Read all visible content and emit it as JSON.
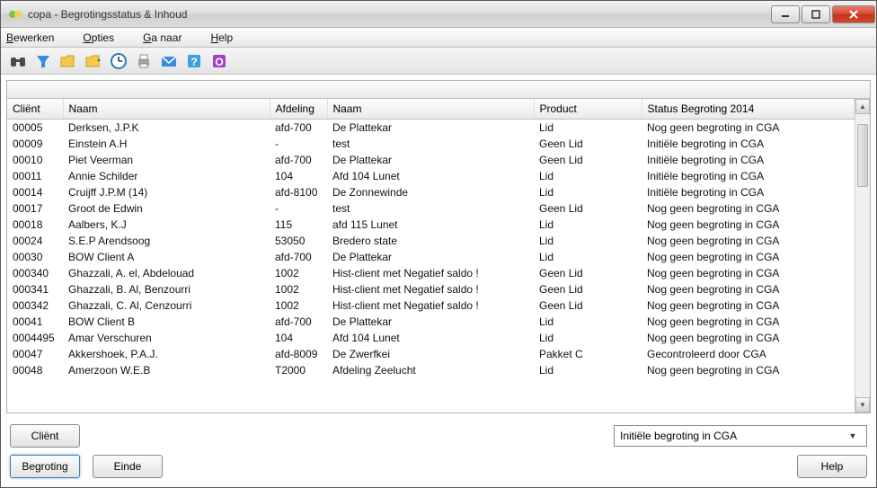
{
  "window": {
    "title": "copa - Begrotingsstatus & Inhoud"
  },
  "menu": {
    "bewerken": "Bewerken",
    "opties": "Opties",
    "ga_naar": "Ga naar",
    "help": "Help"
  },
  "columns": {
    "client": "Cliënt",
    "naam": "Naam",
    "afdeling": "Afdeling",
    "naam2": "Naam",
    "product": "Product",
    "status": "Status Begroting 2014"
  },
  "rows": [
    {
      "client": "00005",
      "naam": "Derksen, J.P.K",
      "afdeling": "afd-700",
      "naam2": "De Plattekar",
      "product": "Lid",
      "status": "Nog geen begroting in CGA"
    },
    {
      "client": "00009",
      "naam": "Einstein  A.H",
      "afdeling": "-",
      "naam2": "test",
      "product": "Geen Lid",
      "status": "Initiële begroting in CGA"
    },
    {
      "client": "00010",
      "naam": "Piet Veerman",
      "afdeling": "afd-700",
      "naam2": "De Plattekar",
      "product": "Geen Lid",
      "status": "Initiële begroting in CGA"
    },
    {
      "client": "00011",
      "naam": "Annie Schilder",
      "afdeling": "104",
      "naam2": "Afd 104 Lunet",
      "product": "Lid",
      "status": "Initiële begroting in CGA"
    },
    {
      "client": "00014",
      "naam": "Cruijff J.P.M (14)",
      "afdeling": "afd-8100",
      "naam2": "De Zonnewinde",
      "product": "Lid",
      "status": "Initiële begroting in CGA"
    },
    {
      "client": "00017",
      "naam": "Groot de Edwin",
      "afdeling": "-",
      "naam2": "test",
      "product": "Geen Lid",
      "status": "Nog geen begroting in CGA"
    },
    {
      "client": "00018",
      "naam": "Aalbers, K.J",
      "afdeling": "115",
      "naam2": "afd 115 Lunet",
      "product": "Lid",
      "status": "Nog geen begroting in CGA"
    },
    {
      "client": "00024",
      "naam": "S.E.P Arendsoog",
      "afdeling": "53050",
      "naam2": "Bredero state",
      "product": "Lid",
      "status": "Nog geen begroting in CGA"
    },
    {
      "client": "00030",
      "naam": "BOW Client A",
      "afdeling": "afd-700",
      "naam2": "De Plattekar",
      "product": "Lid",
      "status": "Nog geen begroting in CGA"
    },
    {
      "client": "000340",
      "naam": "Ghazzali, A. el, Abdelouad",
      "afdeling": "1002",
      "naam2": "Hist-client met Negatief saldo !",
      "product": "Geen Lid",
      "status": "Nog geen begroting in CGA"
    },
    {
      "client": "000341",
      "naam": "Ghazzali, B. Al, Benzourri",
      "afdeling": "1002",
      "naam2": "Hist-client met Negatief saldo !",
      "product": "Geen Lid",
      "status": "Nog geen begroting in CGA"
    },
    {
      "client": "000342",
      "naam": "Ghazzali, C. Al, Cenzourri",
      "afdeling": "1002",
      "naam2": "Hist-client met Negatief saldo !",
      "product": "Geen Lid",
      "status": "Nog geen begroting in CGA"
    },
    {
      "client": "00041",
      "naam": "BOW Client B",
      "afdeling": "afd-700",
      "naam2": "De Plattekar",
      "product": "Lid",
      "status": "Nog geen begroting in CGA"
    },
    {
      "client": "0004495",
      "naam": "Amar Verschuren",
      "afdeling": "104",
      "naam2": "Afd 104 Lunet",
      "product": "Lid",
      "status": "Nog geen begroting in CGA"
    },
    {
      "client": "00047",
      "naam": "Akkershoek, P.A.J.",
      "afdeling": "afd-8009",
      "naam2": "De Zwerfkei",
      "product": "Pakket C",
      "status": "Gecontroleerd door CGA"
    },
    {
      "client": "00048",
      "naam": "Amerzoon W.E.B",
      "afdeling": "T2000",
      "naam2": "Afdeling Zeelucht",
      "product": "Lid",
      "status": "Nog geen begroting in CGA"
    }
  ],
  "bottom": {
    "client_btn": "Cliënt",
    "begroting_btn": "Begroting",
    "einde_btn": "Einde",
    "help_btn": "Help",
    "dropdown_value": "Initiële begroting in CGA"
  }
}
